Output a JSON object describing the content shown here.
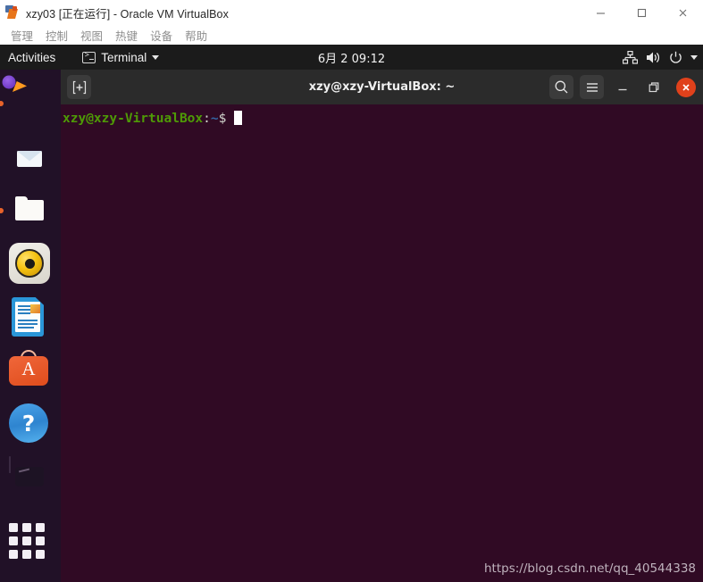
{
  "host_window": {
    "app_icon": "virtualbox-icon",
    "title": "xzy03 [正在运行] - Oracle VM VirtualBox",
    "minimize_label": "—",
    "maximize_label": "□",
    "close_label": "✕",
    "menu": [
      {
        "label": "管理"
      },
      {
        "label": "控制"
      },
      {
        "label": "视图"
      },
      {
        "label": "热键"
      },
      {
        "label": "设备"
      },
      {
        "label": "帮助"
      }
    ]
  },
  "gnome_topbar": {
    "activities": "Activities",
    "app_menu": "Terminal",
    "app_icon": "terminal-icon",
    "clock": "6月 2  09:12",
    "status_icons": [
      "network-wired-icon",
      "volume-icon",
      "power-icon",
      "chevron-down-icon"
    ]
  },
  "dock": {
    "items": [
      {
        "name": "firefox",
        "label": "Firefox",
        "running": true
      },
      {
        "name": "thunderbird",
        "label": "Thunderbird Mail",
        "running": false
      },
      {
        "name": "files",
        "label": "Files",
        "running": true
      },
      {
        "name": "rhythmbox",
        "label": "Rhythmbox",
        "running": false
      },
      {
        "name": "libreoffice-writer",
        "label": "LibreOffice Writer",
        "running": false
      },
      {
        "name": "ubuntu-software",
        "label": "Ubuntu Software",
        "glyph": "A",
        "running": false
      },
      {
        "name": "help",
        "label": "Help",
        "glyph": "?",
        "running": false
      },
      {
        "name": "trash",
        "label": "Trash",
        "running": false
      },
      {
        "name": "show-applications",
        "label": "Show Applications",
        "running": false
      }
    ]
  },
  "terminal": {
    "title": "xzy@xzy-VirtualBox: ~",
    "new_tab_label": "+",
    "search_label": "Search",
    "menu_label": "Menu",
    "minimize_label": "—",
    "maximize_label": "❐",
    "close_label": "✕",
    "prompt": {
      "user_host": "xzy@xzy-VirtualBox",
      "colon": ":",
      "path": "~",
      "symbol": "$",
      "command": ""
    }
  },
  "watermark": "https://blog.csdn.net/qq_40544338",
  "colors": {
    "terminal_bg": "#300a24",
    "terminal_header": "#2b2b2b",
    "topbar_bg": "#1b1b1b",
    "dock_bg": "#201228",
    "close_accent": "#e0411b",
    "prompt_user": "#4e9a06",
    "prompt_path": "#3465a4"
  }
}
